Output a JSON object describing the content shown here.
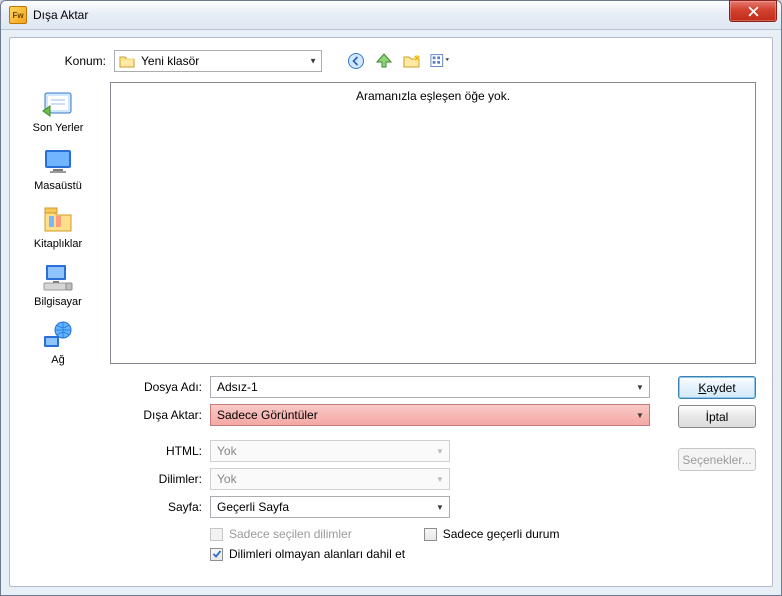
{
  "window": {
    "title": "Dışa Aktar"
  },
  "location": {
    "label": "Konum:",
    "folder": "Yeni klasör",
    "icons": [
      "back",
      "up",
      "new-folder",
      "views"
    ]
  },
  "places": [
    {
      "key": "recent",
      "label": "Son Yerler"
    },
    {
      "key": "desktop",
      "label": "Masaüstü"
    },
    {
      "key": "libraries",
      "label": "Kitaplıklar"
    },
    {
      "key": "computer",
      "label": "Bilgisayar"
    },
    {
      "key": "network",
      "label": "Ağ"
    }
  ],
  "file_area": {
    "empty_text": "Aramanızla eşleşen öğe yok."
  },
  "form": {
    "filename_label": "Dosya Adı:",
    "filename_value": "Adsız-1",
    "export_label": "Dışa Aktar:",
    "export_value": "Sadece Görüntüler",
    "html_label": "HTML:",
    "html_value": "Yok",
    "slices_label": "Dilimler:",
    "slices_value": "Yok",
    "page_label": "Sayfa:",
    "page_value": "Geçerli Sayfa",
    "chk_selected_slices": "Sadece seçilen dilimler",
    "chk_current_state": "Sadece geçerli durum",
    "chk_include_nonslice": "Dilimleri olmayan alanları dahil et"
  },
  "buttons": {
    "save": "Kaydet",
    "save_ul": "K",
    "cancel": "İptal",
    "options": "Seçenekler..."
  }
}
